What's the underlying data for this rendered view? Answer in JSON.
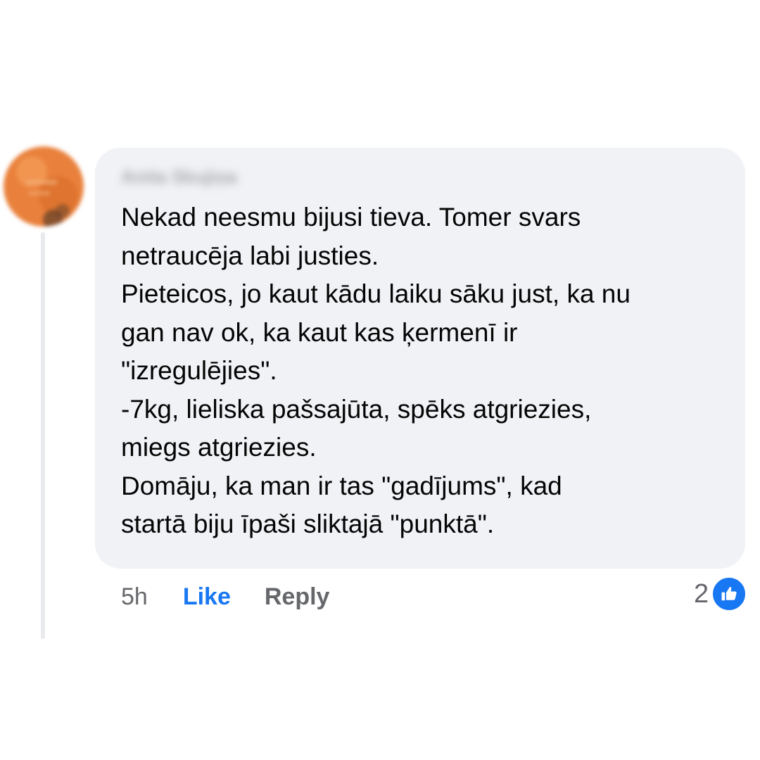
{
  "comment": {
    "author_name": "Anita Skujiņa",
    "avatar_icon": "profile-photo",
    "text_lines": [
      "Nekad neesmu bijusi tieva. Tomer svars",
      "netraucēja labi justies.",
      "Pieteicos, jo kaut kādu laiku sāku just, ka nu",
      "gan nav ok, ka kaut kas ķermenī ir",
      "\"izregulējies\".",
      "-7kg, lieliska pašsajūta, spēks atgriezies,",
      "miegs atgriezies.",
      "Domāju, ka man ir tas \"gadījums\", kad",
      "startā biju īpaši sliktajā \"punktā\"."
    ],
    "timestamp": "5h",
    "like_label": "Like",
    "reply_label": "Reply",
    "reaction_count": "2",
    "reaction_icon": "like-thumbs-up-icon"
  },
  "colors": {
    "bubble_background": "#f0f2f5",
    "text_primary": "#050505",
    "text_secondary": "#65676b",
    "accent_blue": "#1877f2",
    "avatar_orange": "#e9813c"
  }
}
